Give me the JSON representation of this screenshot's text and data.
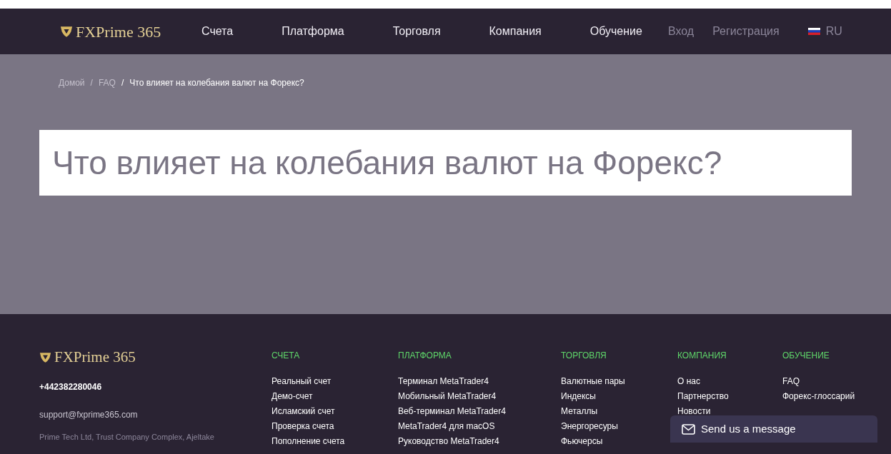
{
  "header": {
    "logo": "FXPrime 365",
    "nav": [
      "Счета",
      "Платформа",
      "Торговля",
      "Компания",
      "Обучение"
    ],
    "login": "Вход",
    "register": "Регистрация",
    "language": "RU"
  },
  "breadcrumbs": [
    {
      "label": "Домой",
      "current": false
    },
    {
      "label": "FAQ",
      "current": false
    },
    {
      "label": "Что влияет на колебания валют на Форекс?",
      "current": true
    }
  ],
  "separator": "/",
  "page_title": "Что влияет на колебания валют на Форекс?",
  "footer": {
    "logo": "FXPrime 365",
    "phone": "+442382280046",
    "email": "support@fxprime365.com",
    "address": "Prime Tech Ltd, Trust Company Complex, Ajeltake",
    "columns": [
      {
        "heading": "СЧЕТА",
        "links": [
          "Реальный счет",
          "Демо-счет",
          "Исламский счет",
          "Проверка счета",
          "Пополнение счета"
        ]
      },
      {
        "heading": "ПЛАТФОРМА",
        "links": [
          "Терминал MetaTrader4",
          "Мобильный MetaTrader4",
          "Веб-терминал MetaTrader4",
          "MetaTrader4 для macOS",
          "Руководство MetaTrader4"
        ]
      },
      {
        "heading": "ТОРГОВЛЯ",
        "links": [
          "Валютные пары",
          "Индексы",
          "Металлы",
          "Энергоресуры",
          "Фьючерсы"
        ]
      },
      {
        "heading": "КОМПАНИЯ",
        "links": [
          "О нас",
          "Партнерство",
          "Новости"
        ]
      },
      {
        "heading": "ОБУЧЕНИЕ",
        "links": [
          "FAQ",
          "Форекс-глоссарий"
        ]
      }
    ]
  },
  "chat": {
    "label": "Send us a message"
  }
}
